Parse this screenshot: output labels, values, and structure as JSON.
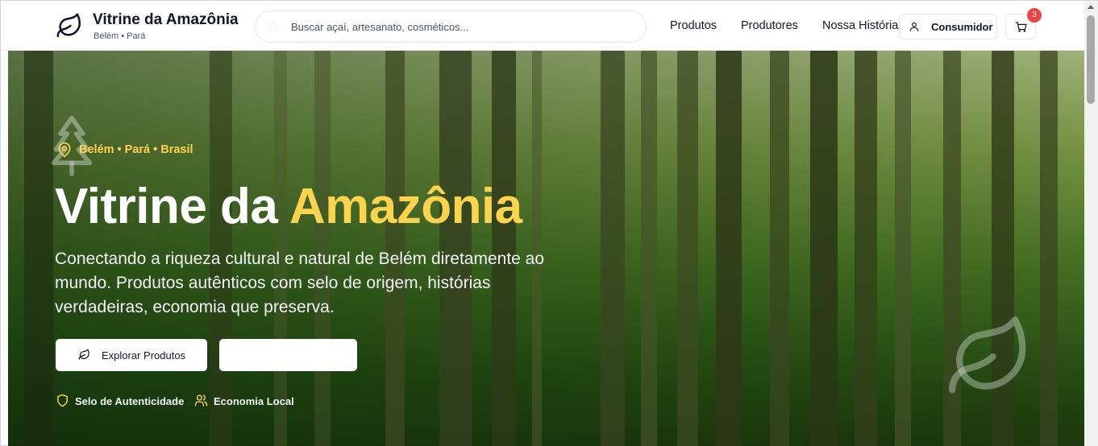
{
  "header": {
    "brand_title": "Vitrine da Amazônia",
    "brand_subtitle": "Belém • Pará",
    "logo_icon": "leaf-icon",
    "search": {
      "placeholder": "Buscar açaí, artesanato, cosméticos...",
      "icon": "search-icon"
    },
    "nav": [
      {
        "label": "Produtos"
      },
      {
        "label": "Produtores"
      },
      {
        "label": "Nossa História"
      }
    ],
    "consumer_button": {
      "label": "Consumidor",
      "icon": "user-icon"
    },
    "cart": {
      "icon": "cart-icon",
      "badge_count": "3",
      "badge_color": "#ef4444"
    }
  },
  "hero": {
    "location": "Belém • Pará • Brasil",
    "title_main": "Vitrine da ",
    "title_accent": "Amazônia",
    "accent_color": "#fcd34d",
    "description": "Conectando a riqueza cultural e natural de Belém diretamente ao mundo. Produtos autênticos com selo de origem, histórias verdadeiras, economia que preserva.",
    "primary_button": {
      "label": "Explorar Produtos",
      "icon": "leaf-icon"
    },
    "secondary_button": {
      "label": ""
    },
    "features": [
      {
        "label": "Selo de Autenticidade",
        "icon": "shield-icon"
      },
      {
        "label": "Economia Local",
        "icon": "users-icon"
      }
    ],
    "decor_icons": [
      "tree-icon",
      "map-pin-icon",
      "leaf-icon"
    ]
  }
}
